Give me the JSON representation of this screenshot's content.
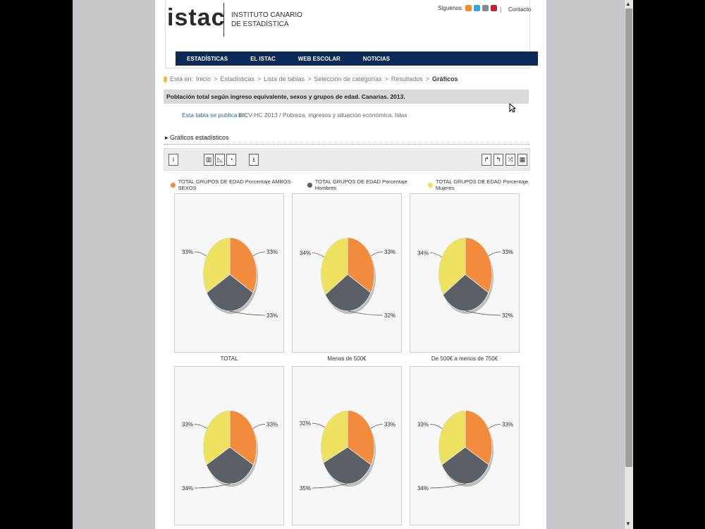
{
  "header": {
    "logo_text": "istac",
    "org_line1": "INSTITUTO CANARIO",
    "org_line2": "DE ESTADÍSTICA",
    "social_label": "Síguenos:",
    "contact": "Contacto",
    "pipe": "|"
  },
  "nav": {
    "items": [
      "ESTADÍSTICAS",
      "EL ISTAC",
      "WEB ESCOLAR",
      "NOTICIAS"
    ]
  },
  "breadcrumb": {
    "prefix": "Está en:",
    "items": [
      "Inicio",
      "Estadísticas",
      "Lista de tablas",
      "Selección de categorías",
      "Resultados"
    ],
    "current": "Gráficos",
    "sep": ">"
  },
  "table_title": "Población total según ingreso equivalente, sexos y grupos de edad. Canarias. 2013.",
  "publication": {
    "label": "Esta tabla se publica en:",
    "value": "EICV-HC 2013 / Pobreza, ingresos y situación económica. Islas"
  },
  "section_title": "Gráficos estadísticos",
  "toolbar": {
    "info_icon": "info-icon",
    "chart_icons": [
      "bar-chart-icon",
      "line-chart-icon",
      "pie-chart-icon"
    ],
    "download_icon": "download-icon",
    "right_icons": [
      "export-icon",
      "undo-icon",
      "rotate-icon",
      "table-icon"
    ],
    "info_glyph": "i",
    "download_glyph": "⭳",
    "right_glyphs": [
      "↱",
      "↰",
      "⤨",
      "▦"
    ]
  },
  "colors": {
    "orange": "#f28c3c",
    "gray": "#5a6066",
    "yellow": "#ede160",
    "nav": "#0c2a55"
  },
  "chart_data": {
    "type": "pie",
    "series": [
      {
        "name": "TOTAL GRUPOS DE EDAD Porcentaje AMBOS SEXOS",
        "color": "#f28c3c"
      },
      {
        "name": "TOTAL GRUPOS DE EDAD Porcentaje Hombres",
        "color": "#5a6066"
      },
      {
        "name": "TOTAL GRUPOS DE EDAD Porcentaje Mujeres",
        "color": "#ede160"
      }
    ],
    "charts": [
      {
        "title": "TOTAL",
        "values": [
          33,
          33,
          33
        ],
        "labels": [
          "33%",
          "33%",
          "33%"
        ]
      },
      {
        "title": "Menos de 500€",
        "values": [
          33,
          32,
          34
        ],
        "labels": [
          "33%",
          "32%",
          "34%"
        ]
      },
      {
        "title": "De 500€ a menos de 750€",
        "values": [
          33,
          32,
          34
        ],
        "labels": [
          "33%",
          "32%",
          "34%"
        ]
      },
      {
        "title": "",
        "values": [
          33,
          34,
          33
        ],
        "labels": [
          "33%",
          "34%",
          "33%"
        ]
      },
      {
        "title": "",
        "values": [
          33,
          35,
          32
        ],
        "labels": [
          "33%",
          "35%",
          "32%"
        ]
      },
      {
        "title": "",
        "values": [
          33,
          34,
          33
        ],
        "labels": [
          "33%",
          "34%",
          "33%"
        ]
      }
    ]
  }
}
